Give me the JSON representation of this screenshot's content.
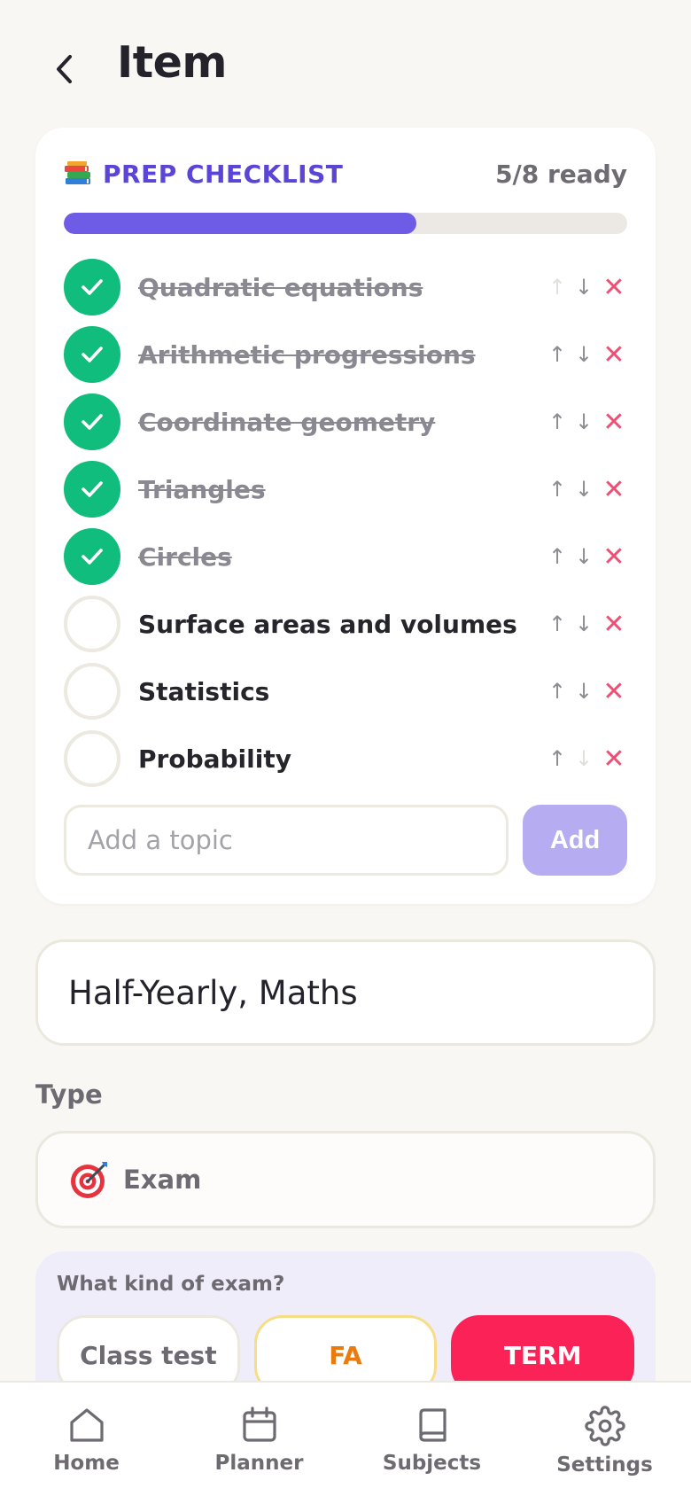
{
  "header": {
    "title": "Item"
  },
  "checklist": {
    "title": "PREP CHECKLIST",
    "ready_text": "5/8 ready",
    "progress": 0.625,
    "items": [
      {
        "label": "Quadratic equations",
        "done": true
      },
      {
        "label": "Arithmetic progressions",
        "done": true
      },
      {
        "label": "Coordinate geometry",
        "done": true
      },
      {
        "label": "Triangles",
        "done": true
      },
      {
        "label": "Circles",
        "done": true
      },
      {
        "label": "Surface areas and volumes",
        "done": false
      },
      {
        "label": "Statistics",
        "done": false
      },
      {
        "label": "Probability",
        "done": false
      }
    ],
    "input_placeholder": "Add a topic",
    "add_label": "Add",
    "up_glyph": "↑",
    "down_glyph": "↓",
    "delete_glyph": "✕"
  },
  "name_field": {
    "value": "Half-Yearly, Maths"
  },
  "type": {
    "label": "Type",
    "value": "Exam",
    "icon": "target-icon"
  },
  "exam_kind": {
    "label": "What kind of exam?",
    "options": [
      "Class test",
      "FA",
      "TERM"
    ],
    "selected": "TERM"
  },
  "tabs": [
    {
      "label": "Home",
      "icon": "home-icon"
    },
    {
      "label": "Planner",
      "icon": "calendar-icon"
    },
    {
      "label": "Subjects",
      "icon": "book-icon"
    },
    {
      "label": "Settings",
      "icon": "gear-icon"
    }
  ],
  "colors": {
    "accent": "#5b45d6",
    "progress": "#6f5ce6",
    "done": "#10bd7d",
    "delete": "#ef4e75",
    "term": "#fb2257",
    "fa": "#ea7b0f"
  }
}
